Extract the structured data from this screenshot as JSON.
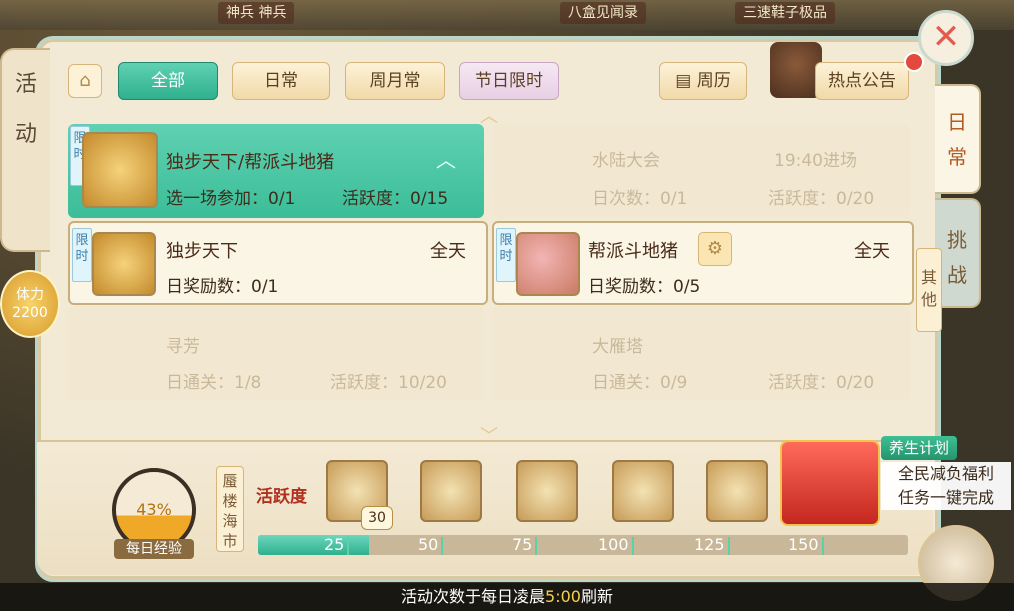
{
  "background": {
    "tags": [
      "神兵 神兵",
      "八盒见闻录",
      "三速鞋子极品"
    ]
  },
  "left_tab": {
    "label_1": "活",
    "label_2": "动"
  },
  "stamina": {
    "label": "体力",
    "value": "2200"
  },
  "tabs": {
    "all": "全部",
    "daily": "日常",
    "weekly": "周月常",
    "festival": "节日限时",
    "calendar": "周历",
    "announcement": "热点公告"
  },
  "side_tabs": {
    "daily": [
      "日",
      "常"
    ],
    "challenge": [
      "挑",
      "战"
    ],
    "other": [
      "其",
      "他"
    ]
  },
  "limited_tag": [
    "限",
    "时"
  ],
  "featured": {
    "title": "独步天下/帮派斗地猪",
    "line": "选一场参加：0/1",
    "activity": "活跃度：0/15"
  },
  "sub_cards": [
    {
      "title": "独步天下",
      "time": "全天",
      "reward": "日奖励数：0/1"
    },
    {
      "title": "帮派斗地猪",
      "time": "全天",
      "reward": "日奖励数：0/5"
    }
  ],
  "ghost_cards": [
    {
      "title": "水陆大会",
      "time": "19:40进场",
      "line1": "日次数：0/1",
      "line2": "活跃度：0/20"
    },
    {
      "title": "寻芳",
      "line1": "日通关：1/8",
      "line2": "活跃度：10/20"
    },
    {
      "title": "大雁塔",
      "line1": "日通关：0/9",
      "line2": "活跃度：0/20"
    }
  ],
  "daily_exp": {
    "percent": "43%",
    "label": "每日经验",
    "fill": 0.43
  },
  "mirage": [
    "蜃",
    "楼",
    "海",
    "市"
  ],
  "activity_label": "活跃度",
  "current_activity": "30",
  "milestones": [
    "25",
    "50",
    "75",
    "100",
    "125",
    "150"
  ],
  "progress": {
    "fill": 0.17
  },
  "promo": {
    "title": "养生计划",
    "line1": "全民减负福利",
    "line2": "任务一键完成"
  },
  "footer": {
    "prefix": "活动次数于每日凌晨",
    "time": "5:00",
    "suffix": "刷新"
  },
  "colors": {
    "accent": "#3bbd98",
    "panel": "#f3ead6",
    "highlight": "#f5d04a",
    "close": "#e25b4e"
  }
}
